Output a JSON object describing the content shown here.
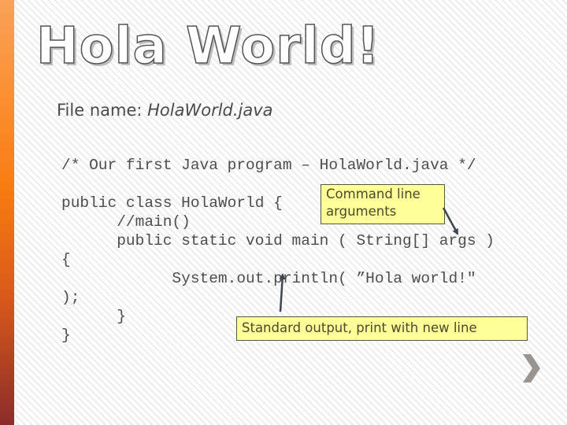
{
  "slide": {
    "title": "Hola World!",
    "file_name_label": "File name: ",
    "file_name_value": "HolaWorld.java",
    "code_lines": [
      "/* Our first Java program – HolaWorld.java */",
      "public class HolaWorld {",
      "      //main()",
      "      public static void main ( String[] args )",
      "{",
      "            System.out.println( ”Hola world!\"",
      ");",
      "      }",
      "}"
    ],
    "callouts": {
      "args": "Command line arguments",
      "args_line1": "Command line",
      "args_line2": "arguments",
      "stdout": "Standard output, print with new line"
    },
    "colors": {
      "accent_bar_top": "#f9a258",
      "accent_bar_mid": "#f77b10",
      "accent_bar_bottom": "#8c2c2c",
      "callout_fill": "#ffff99",
      "chevron": "#9a9490"
    },
    "nav": {
      "next_icon": "chevron-right-icon"
    }
  }
}
